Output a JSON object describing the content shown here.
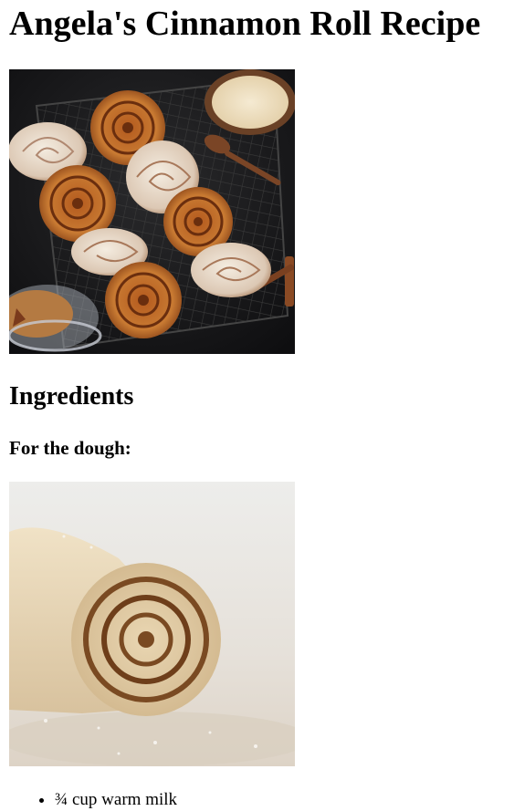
{
  "page": {
    "title": "Angela's Cinnamon Roll Recipe",
    "ingredients_heading": "Ingredients",
    "dough_subheading": "For the dough:"
  },
  "images": [
    {
      "name": "cinnamon-rolls-on-cooling-rack-photo"
    },
    {
      "name": "rolled-dough-log-photo"
    }
  ],
  "dough_ingredients": [
    "¾ cup warm milk"
  ]
}
